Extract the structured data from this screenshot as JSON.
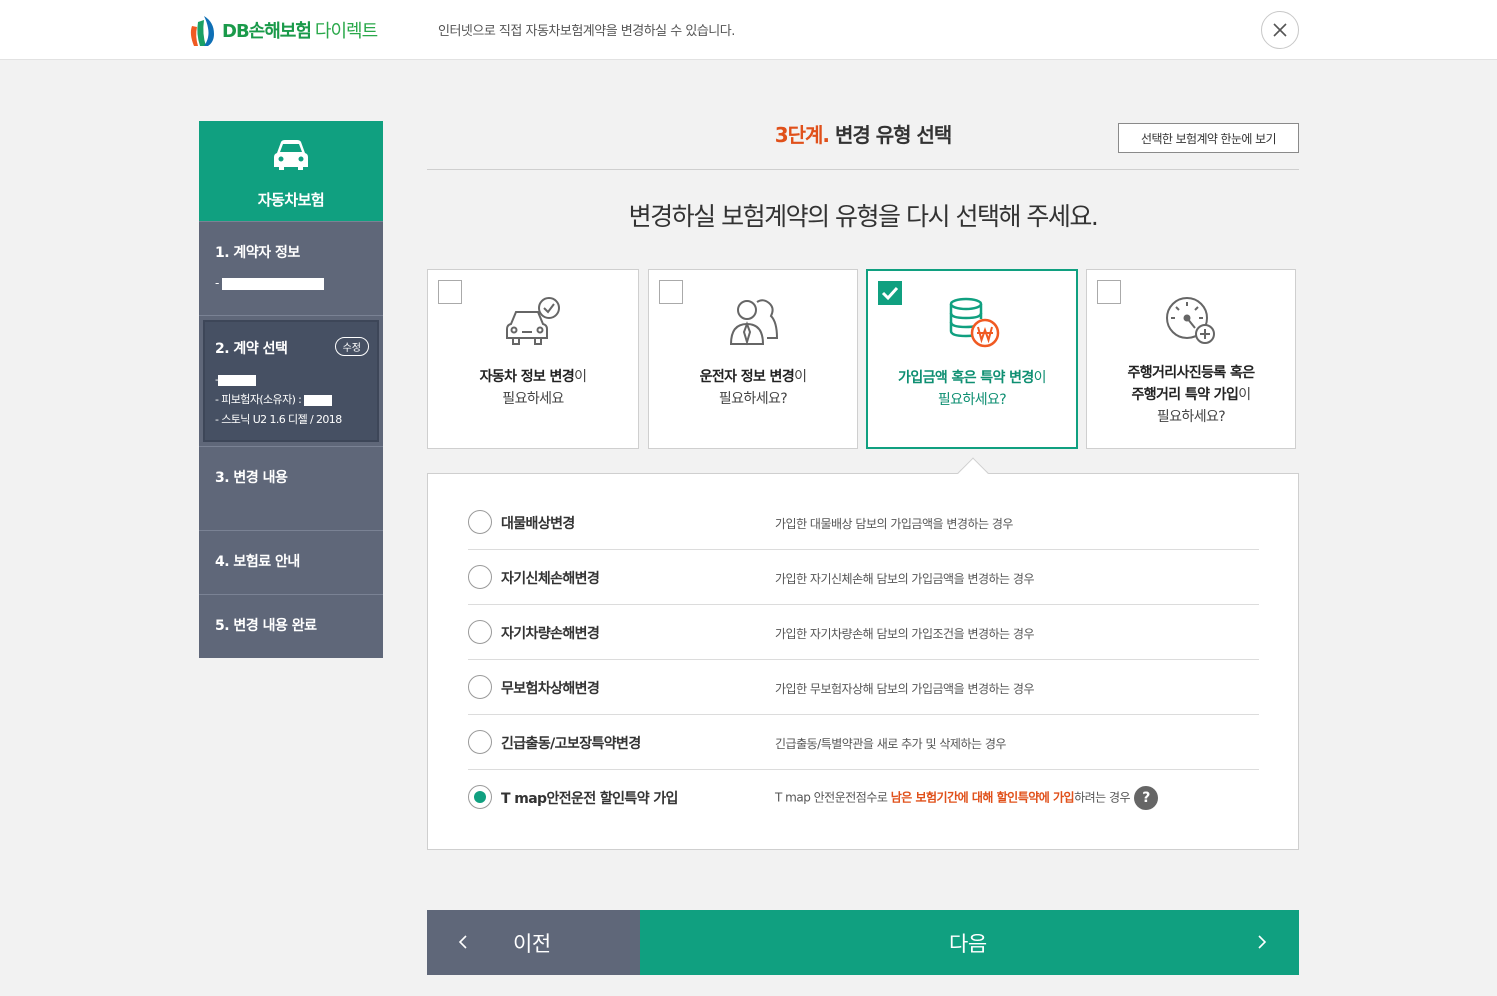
{
  "header": {
    "logo_text_db": "DB손해보험",
    "logo_text_direct": "다이렉트",
    "description": "인터넷으로 직접 자동차보험계약을 변경하실 수 있습니다.",
    "close_icon": "close-icon"
  },
  "sidebar": {
    "product": "자동차보험",
    "steps": [
      {
        "label": "1. 계약자 정보",
        "line_prefix": "-"
      },
      {
        "label": "2. 계약 선택",
        "badge": "수정",
        "line1_prefix": "-",
        "line2": "- 피보험자(소유자) :",
        "line3": "- 스토닉 U2 1.6 디젤 / 2018"
      },
      {
        "label": "3. 변경 내용"
      },
      {
        "label": "4. 보험료 안내"
      },
      {
        "label": "5. 변경 내용 완료"
      }
    ]
  },
  "main": {
    "step_num": "3단계.",
    "step_title": "변경 유형 선택",
    "view_button": "선택한 보험계약 한눈에 보기",
    "heading": "변경하실 보험계약의 유형을 다시 선택해 주세요.",
    "cards": [
      {
        "bold": "자동차 정보 변경",
        "rest": "이",
        "line2": "필요하세요",
        "line3": "",
        "selected": false,
        "icon": "car-check-icon"
      },
      {
        "bold": "운전자 정보 변경",
        "rest": "이",
        "line2": "필요하세요?",
        "line3": "",
        "selected": false,
        "icon": "driver-icon"
      },
      {
        "bold": "가입금액 혹은 특약 변경",
        "rest": "이",
        "line2": "필요하세요?",
        "line3": "",
        "selected": true,
        "icon": "coins-won-icon"
      },
      {
        "bold": "",
        "rest": "주행거리사진등록 혹은",
        "line2b": "주행거리 특약 가입",
        "line2r": "이",
        "line3": "필요하세요?",
        "selected": false,
        "icon": "gauge-plus-icon"
      }
    ],
    "options": [
      {
        "name": "대물배상변경",
        "desc": "가입한 대물배상 담보의 가입금액을 변경하는 경우",
        "selected": false
      },
      {
        "name": "자기신체손해변경",
        "desc": "가입한 자기신체손해 담보의 가입금액을 변경하는 경우",
        "selected": false
      },
      {
        "name": "자기차량손해변경",
        "desc": "가입한 자기차량손해 담보의 가입조건을 변경하는 경우",
        "selected": false
      },
      {
        "name": "무보험차상해변경",
        "desc": "가입한 무보험자상해 담보의 가입금액을 변경하는 경우",
        "selected": false
      },
      {
        "name": "긴급출동/고보장특약변경",
        "desc": "긴급출동/특별약관을 새로 추가 및 삭제하는 경우",
        "selected": false
      },
      {
        "name": "T map안전운전 할인특약 가입",
        "desc_pre": "T map 안전운전점수로 ",
        "desc_hl": "남은 보험기간에 대해 할인특약에 가입",
        "desc_post": "하려는 경우",
        "help": "?",
        "selected": true
      }
    ]
  },
  "footer": {
    "prev": "이전",
    "next": "다음"
  },
  "colors": {
    "accent": "#10a080",
    "highlight": "#e0501a",
    "sidebar": "#5f6779"
  }
}
